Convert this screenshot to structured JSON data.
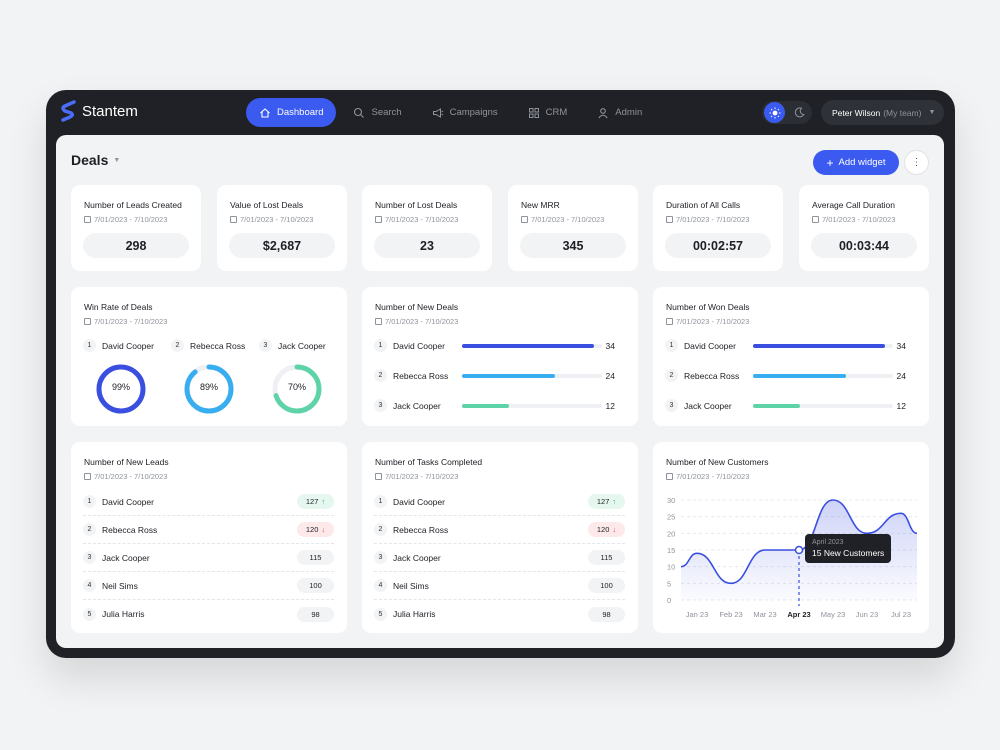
{
  "app": {
    "name": "Stantem"
  },
  "nav": [
    {
      "label": "Dashboard",
      "icon": "home-icon",
      "active": true
    },
    {
      "label": "Search",
      "icon": "search-icon"
    },
    {
      "label": "Campaigns",
      "icon": "megaphone-icon"
    },
    {
      "label": "CRM",
      "icon": "grid-icon"
    },
    {
      "label": "Admin",
      "icon": "user-icon"
    }
  ],
  "user": {
    "name": "Peter Wilson",
    "team": "(My team)"
  },
  "page": {
    "title": "Deals",
    "add_widget_label": "Add widget"
  },
  "date_range": "7/01/2023 - 7/10/2023",
  "kpis": [
    {
      "title": "Number of Leads Created",
      "value": "298"
    },
    {
      "title": "Value of Lost Deals",
      "value": "$2,687"
    },
    {
      "title": "Number of Lost Deals",
      "value": "23"
    },
    {
      "title": "New MRR",
      "value": "345"
    },
    {
      "title": "Duration of All Calls",
      "value": "00:02:57"
    },
    {
      "title": "Average Call Duration",
      "value": "00:03:44"
    }
  ],
  "win_rate": {
    "title": "Win Rate of Deals",
    "people": [
      {
        "rank": "1",
        "name": "David Cooper",
        "percent": 99,
        "label": "99%",
        "color": "#3a4fe0"
      },
      {
        "rank": "2",
        "name": "Rebecca Ross",
        "percent": 89,
        "label": "89%",
        "color": "#38aef0"
      },
      {
        "rank": "3",
        "name": "Jack Cooper",
        "percent": 70,
        "label": "70%",
        "color": "#5fd3a8"
      }
    ]
  },
  "new_deals": {
    "title": "Number of New Deals",
    "max": 36,
    "rows": [
      {
        "rank": "1",
        "name": "David Cooper",
        "value": 34,
        "value_label": "34",
        "color": "#3a4fe0"
      },
      {
        "rank": "2",
        "name": "Rebecca Ross",
        "value": 24,
        "value_label": "24",
        "color": "#38aef0"
      },
      {
        "rank": "3",
        "name": "Jack Cooper",
        "value": 12,
        "value_label": "12",
        "color": "#5fd3a8"
      }
    ]
  },
  "won_deals": {
    "title": "Number of Won Deals",
    "max": 36,
    "rows": [
      {
        "rank": "1",
        "name": "David Cooper",
        "value": 34,
        "value_label": "34",
        "color": "#3a4fe0"
      },
      {
        "rank": "2",
        "name": "Rebecca Ross",
        "value": 24,
        "value_label": "24",
        "color": "#38aef0"
      },
      {
        "rank": "3",
        "name": "Jack Cooper",
        "value": 12,
        "value_label": "12",
        "color": "#5fd3a8"
      }
    ]
  },
  "new_leads": {
    "title": "Number of New Leads",
    "rows": [
      {
        "rank": "1",
        "name": "David Cooper",
        "value": "127",
        "trend": "up"
      },
      {
        "rank": "2",
        "name": "Rebecca Ross",
        "value": "120",
        "trend": "down"
      },
      {
        "rank": "3",
        "name": "Jack Cooper",
        "value": "115",
        "trend": "none"
      },
      {
        "rank": "4",
        "name": "Neil Sims",
        "value": "100",
        "trend": "none"
      },
      {
        "rank": "5",
        "name": "Julia Harris",
        "value": "98",
        "trend": "none"
      }
    ]
  },
  "tasks_completed": {
    "title": "Number of Tasks Completed",
    "rows": [
      {
        "rank": "1",
        "name": "David Cooper",
        "value": "127",
        "trend": "up"
      },
      {
        "rank": "2",
        "name": "Rebecca Ross",
        "value": "120",
        "trend": "down"
      },
      {
        "rank": "3",
        "name": "Jack Cooper",
        "value": "115",
        "trend": "none"
      },
      {
        "rank": "4",
        "name": "Neil Sims",
        "value": "100",
        "trend": "none"
      },
      {
        "rank": "5",
        "name": "Julia Harris",
        "value": "98",
        "trend": "none"
      }
    ]
  },
  "new_customers": {
    "title": "Number of New Customers",
    "tooltip": {
      "date": "April 2023",
      "text": "15 New Customers"
    }
  },
  "chart_data": {
    "type": "area",
    "title": "Number of New Customers",
    "categories": [
      "Jan 23",
      "Feb 23",
      "Mar 23",
      "Apr 23",
      "May 23",
      "Jun 23",
      "Jul 23"
    ],
    "series": [
      {
        "values": [
          14,
          5,
          15,
          15,
          30,
          20,
          26
        ]
      }
    ],
    "yticks": [
      0,
      5,
      10,
      15,
      20,
      25,
      30
    ],
    "ylim": [
      0,
      30
    ],
    "highlight_category": "Apr 23",
    "color": "#3a4fe0"
  }
}
